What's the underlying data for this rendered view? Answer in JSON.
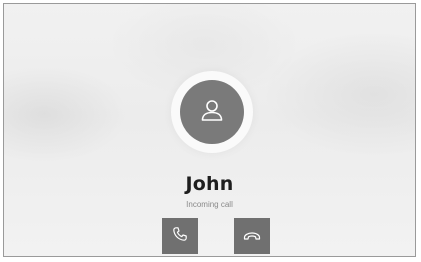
{
  "call": {
    "caller_name": "John",
    "status": "Incoming call"
  },
  "icons": {
    "avatar": "person-icon",
    "answer": "phone-icon",
    "decline": "phone-hangup-icon"
  },
  "colors": {
    "background": "#ededed",
    "avatar_fill": "#7a7a7a",
    "button_fill": "#707070",
    "icon_stroke": "#ffffff",
    "name_text": "#1e1e1e",
    "status_text": "#8a8a8a"
  }
}
